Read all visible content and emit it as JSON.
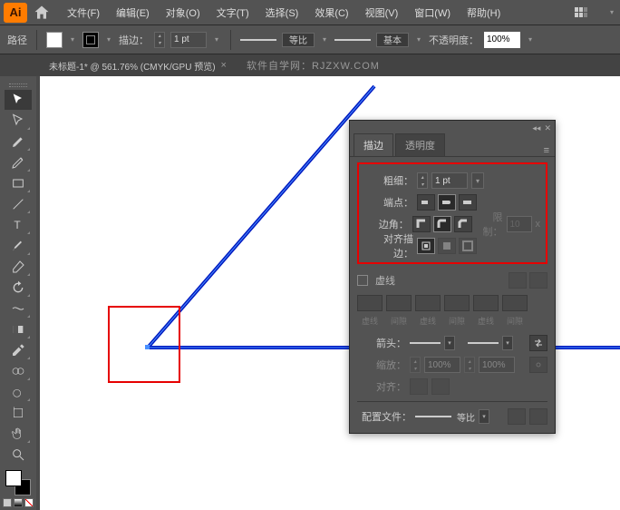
{
  "menubar": {
    "file": "文件(F)",
    "edit": "编辑(E)",
    "object": "对象(O)",
    "type": "文字(T)",
    "select": "选择(S)",
    "effect": "效果(C)",
    "view": "视图(V)",
    "window": "窗口(W)",
    "help": "帮助(H)"
  },
  "control": {
    "path_label": "路径",
    "stroke_label": "描边：",
    "stroke_pt": "1 pt",
    "preset1": "等比",
    "preset2": "基本",
    "opacity_label": "不透明度：",
    "opacity_val": "100%"
  },
  "tabs": {
    "doc_title": "未标题-1* @ 561.76% (CMYK/GPU 预览)",
    "watermark": "软件自学网：RJZXW.COM"
  },
  "panel": {
    "tab_stroke": "描边",
    "tab_opacity": "透明度",
    "weight_label": "粗细：",
    "weight_val": "1 pt",
    "cap_label": "端点：",
    "join_label": "边角：",
    "limit_label": "限制：",
    "limit_val": "10",
    "limit_x": "x",
    "align_label": "对齐描边：",
    "dashed_label": "虚线",
    "dash_h1": "虚线",
    "dash_h2": "间隙",
    "dash_h3": "虚线",
    "dash_h4": "间隙",
    "dash_h5": "虚线",
    "dash_h6": "间隙",
    "arrow_label": "箭头：",
    "scale_label": "缩放：",
    "scale1": "100%",
    "scale2": "100%",
    "align2_label": "对齐：",
    "profile_label": "配置文件：",
    "profile_preset": "等比"
  }
}
